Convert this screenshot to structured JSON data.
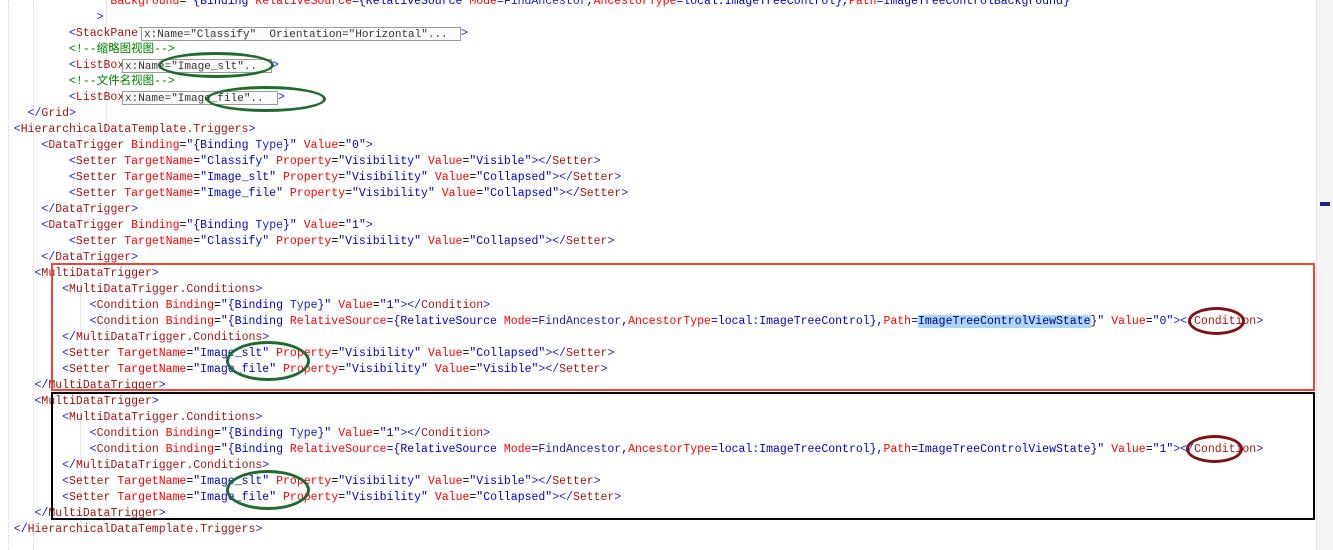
{
  "editor": {
    "language": "XAML",
    "font_size_px": 11.5,
    "line_height_px": 16,
    "background": "#ffffff",
    "colors": {
      "bracket": "#1a1ad0",
      "tag": "#a31515",
      "attribute": "#ff0000",
      "value": "#0000c8",
      "comment": "#008000",
      "selection": "#add6ff",
      "annotation_red": "#f0443a",
      "annotation_black": "#000000",
      "annotation_green": "#1f6b2e",
      "annotation_darkred": "#7e1214"
    },
    "selected_text": "ImageTreeControlViewState",
    "scrollbar_mark_label": "change-mark"
  },
  "lines": [
    {
      "indent": 0,
      "text": "Background=\"{Binding RelativeSource={RelativeSource Mode=FindAncestor,AncestorType=local:ImageTreeControl},Path=ImageTreeControlBackground}"
    },
    {
      "indent": 0,
      "text": ">"
    },
    {
      "indent": 0,
      "text": "<StackPanel x:Name=\"Classify\" Orientation=\"Horizontal\"...>"
    },
    {
      "indent": 0,
      "text": "<!--缩略图视图-->"
    },
    {
      "indent": 0,
      "text": "<ListBox x:Name=\"Image_slt\"..>"
    },
    {
      "indent": 0,
      "text": "<!--文件名视图-->"
    },
    {
      "indent": 0,
      "text": "<ListBox x:Name=\"Image_file\"..>"
    },
    {
      "indent": 0,
      "text": "</Grid>"
    },
    {
      "indent": 0,
      "text": "<HierarchicalDataTemplate.Triggers>"
    },
    {
      "indent": 0,
      "text": "<DataTrigger Binding=\"{Binding Type}\" Value=\"0\">"
    },
    {
      "indent": 0,
      "text": "<Setter TargetName=\"Classify\" Property=\"Visibility\" Value=\"Visible\"></Setter>"
    },
    {
      "indent": 0,
      "text": "<Setter TargetName=\"Image_slt\" Property=\"Visibility\" Value=\"Collapsed\"></Setter>"
    },
    {
      "indent": 0,
      "text": "<Setter TargetName=\"Image_file\" Property=\"Visibility\" Value=\"Collapsed\"></Setter>"
    },
    {
      "indent": 0,
      "text": "</DataTrigger>"
    },
    {
      "indent": 0,
      "text": "<DataTrigger Binding=\"{Binding Type}\" Value=\"1\">"
    },
    {
      "indent": 0,
      "text": "<Setter TargetName=\"Classify\" Property=\"Visibility\" Value=\"Collapsed\"></Setter>"
    },
    {
      "indent": 0,
      "text": "</DataTrigger>"
    },
    {
      "indent": 0,
      "text": "<MultiDataTrigger>"
    },
    {
      "indent": 0,
      "text": "<MultiDataTrigger.Conditions>"
    },
    {
      "indent": 0,
      "text": "<Condition Binding=\"{Binding Type}\" Value=\"1\"></Condition>"
    },
    {
      "indent": 0,
      "text": "<Condition Binding=\"{Binding RelativeSource={RelativeSource Mode=FindAncestor,AncestorType=local:ImageTreeControl},Path=ImageTreeControlViewState}\" Value=\"0\"></Condition>"
    },
    {
      "indent": 0,
      "text": "</MultiDataTrigger.Conditions>"
    },
    {
      "indent": 0,
      "text": "<Setter TargetName=\"Image_slt\" Property=\"Visibility\" Value=\"Collapsed\"></Setter>"
    },
    {
      "indent": 0,
      "text": "<Setter TargetName=\"Image_file\" Property=\"Visibility\" Value=\"Visible\"></Setter>"
    },
    {
      "indent": 0,
      "text": "</MultiDataTrigger>"
    },
    {
      "indent": 0,
      "text": "<MultiDataTrigger>"
    },
    {
      "indent": 0,
      "text": "<MultiDataTrigger.Conditions>"
    },
    {
      "indent": 0,
      "text": "<Condition Binding=\"{Binding Type}\" Value=\"1\"></Condition>"
    },
    {
      "indent": 0,
      "text": "<Condition Binding=\"{Binding RelativeSource={RelativeSource Mode=FindAncestor,AncestorType=local:ImageTreeControl},Path=ImageTreeControlViewState}\" Value=\"1\"></Condition>"
    },
    {
      "indent": 0,
      "text": "</MultiDataTrigger.Conditions>"
    },
    {
      "indent": 0,
      "text": "<Setter TargetName=\"Image_slt\" Property=\"Visibility\" Value=\"Visible\"></Setter>"
    },
    {
      "indent": 0,
      "text": "<Setter TargetName=\"Image_file\" Property=\"Visibility\" Value=\"Collapsed\"></Setter>"
    },
    {
      "indent": 0,
      "text": "</MultiDataTrigger>"
    },
    {
      "indent": 0,
      "text": "</HierarchicalDataTemplate.Triggers>"
    }
  ],
  "chips": [
    {
      "label": "x:Name=\"Classify\"  Orientation=\"Horizontal\"...",
      "name": "collapsed-attributes-stackpanel"
    },
    {
      "label": "x:Name=\"Image_slt\"..",
      "name": "collapsed-attributes-listbox-slt"
    },
    {
      "label": "x:Name=\"Image_file\"..",
      "name": "collapsed-attributes-listbox-file"
    }
  ],
  "annotations": {
    "red_box_label": "red-highlight-box-first-multidatatrigger",
    "black_box_label": "black-highlight-box-second-multidatatrigger",
    "green_ellipses": [
      "ellipse-image-slt-declaration",
      "ellipse-image-file-declaration",
      "ellipse-setters-first-multidatatrigger",
      "ellipse-setters-second-multidatatrigger"
    ],
    "darkred_ellipses": [
      "ellipse-viewstate-value-0",
      "ellipse-viewstate-value-1"
    ]
  }
}
